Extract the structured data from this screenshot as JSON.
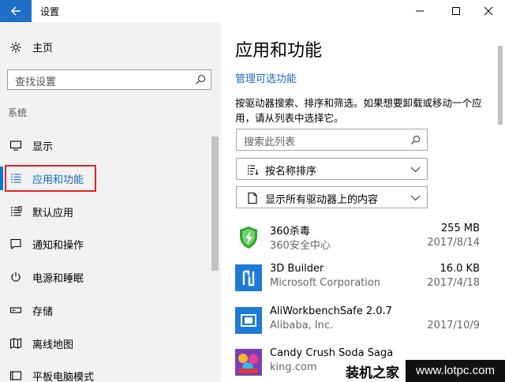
{
  "window": {
    "title": "设置"
  },
  "nav": {
    "home_label": "主页",
    "search_placeholder": "查找设置",
    "section": "系统",
    "items": [
      {
        "label": "显示",
        "icon": "monitor-icon"
      },
      {
        "label": "应用和功能",
        "icon": "list-icon",
        "active": true
      },
      {
        "label": "默认应用",
        "icon": "default-apps-icon"
      },
      {
        "label": "通知和操作",
        "icon": "notification-icon"
      },
      {
        "label": "电源和睡眠",
        "icon": "power-icon"
      },
      {
        "label": "存储",
        "icon": "storage-icon"
      },
      {
        "label": "离线地图",
        "icon": "map-icon"
      },
      {
        "label": "平板电脑模式",
        "icon": "tablet-icon"
      }
    ]
  },
  "content": {
    "title": "应用和功能",
    "manage_link": "管理可选功能",
    "description": "按驱动器搜索、排序和筛选。如果想要卸载或移动一个应用，请从列表中选择它。",
    "search_placeholder": "搜索此列表",
    "sort_label": "按名称排序",
    "filter_label": "显示所有驱动器上的内容",
    "apps": [
      {
        "name": "360杀毒",
        "publisher": "360安全中心",
        "size": "255 MB",
        "date": "2017/8/14",
        "icon": "360-antivirus-icon"
      },
      {
        "name": "3D Builder",
        "publisher": "Microsoft Corporation",
        "size": "16.0 KB",
        "date": "2017/4/18",
        "icon": "3d-builder-icon"
      },
      {
        "name": "AliWorkbenchSafe 2.0.7",
        "publisher": "Alibaba, Inc.",
        "size": "",
        "date": "2017/10/9",
        "icon": "aliworkbench-icon"
      },
      {
        "name": "Candy Crush Soda Saga",
        "publisher": "king.com",
        "size": "",
        "date": "",
        "icon": "candy-crush-icon"
      }
    ]
  },
  "watermark": {
    "text": "装机之家",
    "url": "www.lotpc.com"
  },
  "colors": {
    "accent": "#0078d7",
    "titlebar_back": "#1f6fc6",
    "highlight": "#e02424",
    "link": "#1a6ac0"
  }
}
